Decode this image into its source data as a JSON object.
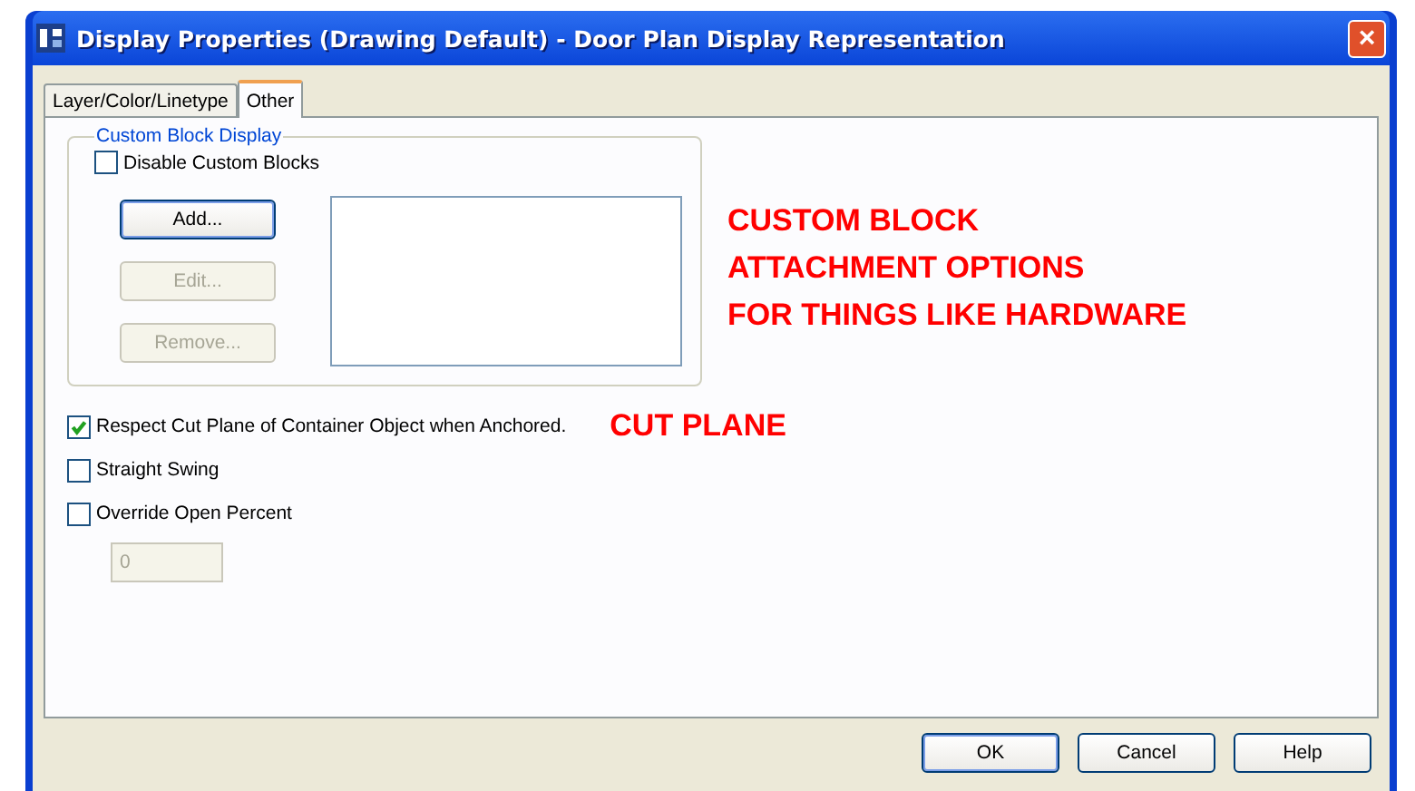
{
  "window": {
    "title": "Display Properties (Drawing Default) - Door Plan Display Representation",
    "close": "×"
  },
  "tabs": [
    {
      "label": "Layer/Color/Linetype",
      "selected": false
    },
    {
      "label": "Other",
      "selected": true
    }
  ],
  "custom_block_display": {
    "title": "Custom Block Display",
    "disable_checkbox": {
      "label": "Disable Custom Blocks",
      "checked": false
    },
    "buttons": [
      {
        "label": "Add...",
        "disabled": false
      },
      {
        "label": "Edit...",
        "disabled": true
      },
      {
        "label": "Remove...",
        "disabled": true
      }
    ]
  },
  "annotation_custom_block": [
    "CUSTOM BLOCK",
    "ATTACHMENT OPTIONS",
    "FOR THINGS LIKE HARDWARE"
  ],
  "options": [
    {
      "label": "Respect Cut Plane of Container Object when Anchored.",
      "checked": true
    },
    {
      "label": "Straight Swing",
      "checked": false
    },
    {
      "label": "Override Open Percent",
      "checked": false
    }
  ],
  "annotation_cut_plane": "CUT PLANE",
  "open_percent_field": {
    "value": "0",
    "disabled": true
  },
  "buttons": [
    {
      "label": "OK",
      "default": true
    },
    {
      "label": "Cancel",
      "default": false
    },
    {
      "label": "Help",
      "default": false
    }
  ]
}
